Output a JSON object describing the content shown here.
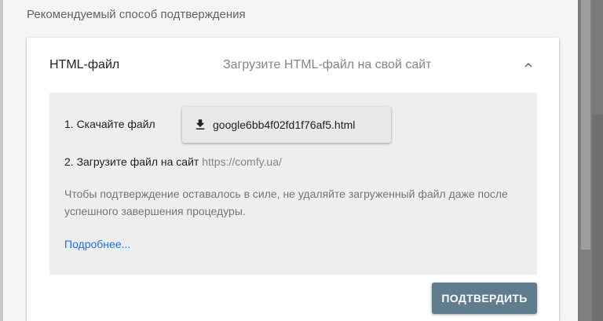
{
  "section": {
    "title": "Рекомендуемый способ подтверждения"
  },
  "method": {
    "name": "HTML-файл",
    "description": "Загрузите HTML-файл на свой сайт",
    "expanded": true,
    "chevron_icon": "chevron-up-icon"
  },
  "steps": {
    "step1_label": "1. Скачайте файл",
    "download_icon": "download-icon",
    "download_file": "google6bb4f02fd1f76af5.html",
    "step2_label": "2. Загрузите файл на сайт",
    "step2_url": "https://comfy.ua/",
    "note": "Чтобы подтверждение оставалось в силе, не удаляйте загруженный файл даже после успешного завершения процедуры.",
    "more_link": "Подробнее..."
  },
  "actions": {
    "confirm_label": "ПОДТВЕРДИТЬ"
  },
  "colors": {
    "confirm_button": "#5f7d8e",
    "link": "#1a73e8",
    "panel": "#eeeeee"
  }
}
